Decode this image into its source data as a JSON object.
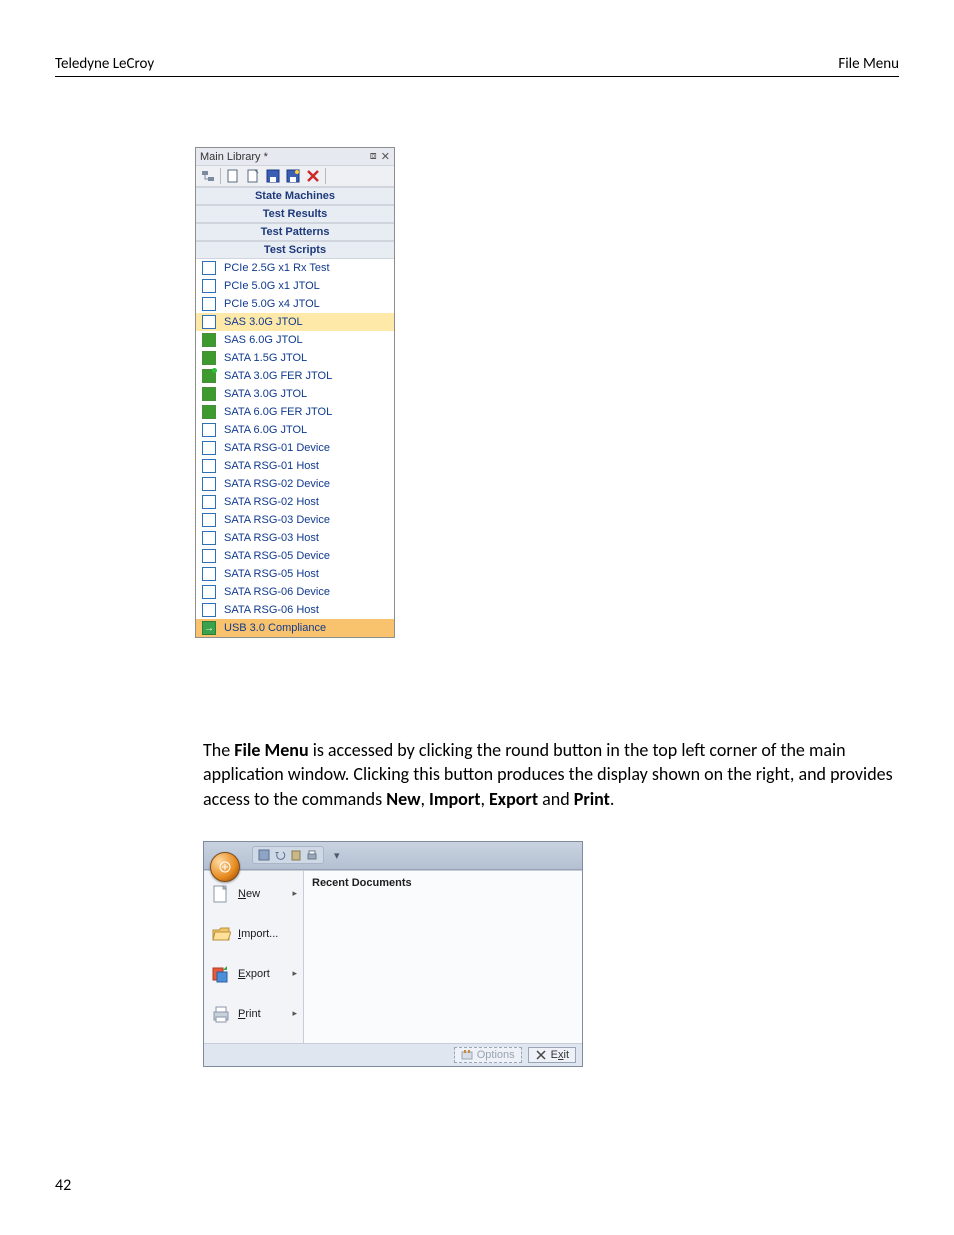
{
  "header": {
    "left": "Teledyne LeCroy",
    "right": "File Menu"
  },
  "library": {
    "title": "Main Library *",
    "toolbar_icons": [
      "folder-tree-icon",
      "new-doc-icon",
      "open-doc-icon",
      "save-icon",
      "save-as-icon",
      "delete-icon"
    ],
    "sections": [
      "State Machines",
      "Test Results",
      "Test Patterns",
      "Test Scripts"
    ],
    "scripts": [
      {
        "label": "PCIe 2.5G x1 Rx Test",
        "icon": "box-empty",
        "sel": ""
      },
      {
        "label": "PCIe 5.0G x1 JTOL",
        "icon": "box-empty",
        "sel": ""
      },
      {
        "label": "PCIe 5.0G x4 JTOL",
        "icon": "box-empty",
        "sel": ""
      },
      {
        "label": "SAS 3.0G JTOL",
        "icon": "box-empty",
        "sel": "yellow"
      },
      {
        "label": "SAS 6.0G JTOL",
        "icon": "box-green",
        "sel": ""
      },
      {
        "label": "SATA 1.5G JTOL",
        "icon": "box-green",
        "sel": ""
      },
      {
        "label": "SATA 3.0G FER JTOL",
        "icon": "box-green-dot",
        "sel": ""
      },
      {
        "label": "SATA 3.0G JTOL",
        "icon": "box-green",
        "sel": ""
      },
      {
        "label": "SATA 6.0G FER JTOL",
        "icon": "box-green",
        "sel": ""
      },
      {
        "label": "SATA 6.0G JTOL",
        "icon": "box-empty",
        "sel": ""
      },
      {
        "label": "SATA RSG-01 Device",
        "icon": "box-empty",
        "sel": ""
      },
      {
        "label": "SATA RSG-01 Host",
        "icon": "box-empty",
        "sel": ""
      },
      {
        "label": "SATA RSG-02 Device",
        "icon": "box-empty",
        "sel": ""
      },
      {
        "label": "SATA RSG-02 Host",
        "icon": "box-empty",
        "sel": ""
      },
      {
        "label": "SATA RSG-03 Device",
        "icon": "box-empty",
        "sel": ""
      },
      {
        "label": "SATA RSG-03 Host",
        "icon": "box-empty",
        "sel": ""
      },
      {
        "label": "SATA RSG-05 Device",
        "icon": "box-empty",
        "sel": ""
      },
      {
        "label": "SATA RSG-05 Host",
        "icon": "box-empty",
        "sel": ""
      },
      {
        "label": "SATA RSG-06 Device",
        "icon": "box-empty",
        "sel": ""
      },
      {
        "label": "SATA RSG-06 Host",
        "icon": "box-empty",
        "sel": ""
      },
      {
        "label": "USB 3.0 Compliance",
        "icon": "arrow",
        "sel": "orange"
      }
    ]
  },
  "paragraph": {
    "pre": "The ",
    "b1": "File Menu",
    "mid1": " is accessed by clicking the round button in the top left corner of the main application window. Clicking this button produces the display shown on the right, and provides access to the commands ",
    "b2": "New",
    "c1": ", ",
    "b3": "Import",
    "c2": ", ",
    "b4": "Export",
    "c3": " and ",
    "b5": "Print",
    "end": "."
  },
  "filemenu": {
    "qat_icons": [
      "save-icon",
      "undo-icon",
      "paste-icon",
      "print-icon"
    ],
    "items": [
      {
        "label_ul": "N",
        "label_rest": "ew",
        "icon": "blank-doc-icon",
        "has_sub": true
      },
      {
        "label_ul": "I",
        "label_rest": "mport...",
        "icon": "folder-open-icon",
        "has_sub": false
      },
      {
        "label_ul": "E",
        "label_rest": "xport",
        "icon": "export-icon",
        "has_sub": true
      },
      {
        "label_ul": "P",
        "label_rest": "rint",
        "icon": "printer-icon",
        "has_sub": true
      }
    ],
    "recent_title": "Recent Documents",
    "options": {
      "label_rest": "Options",
      "ul": ""
    },
    "exit": {
      "label_ul": "x",
      "label_pre": "E",
      "label_post": "it"
    }
  },
  "page_number": "42"
}
